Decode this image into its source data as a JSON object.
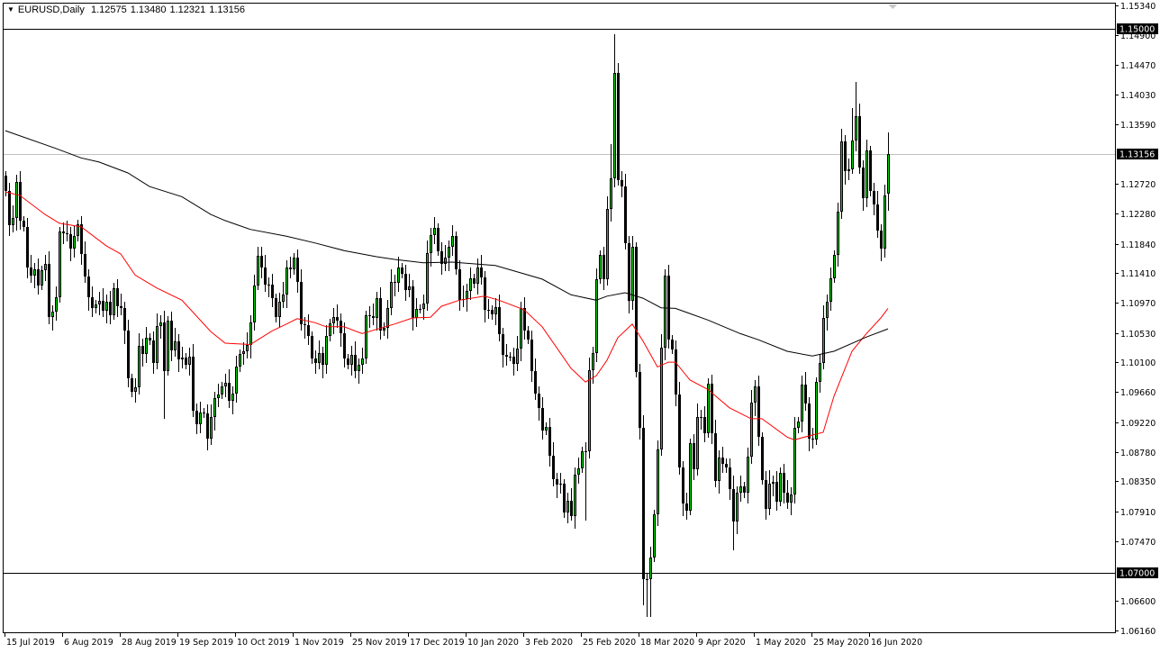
{
  "header": {
    "symbol": "EURUSD,Daily",
    "open": "1.12575",
    "high": "1.13480",
    "low": "1.12321",
    "close": "1.13156"
  },
  "colors": {
    "bull": "#00d000",
    "bear": "#000000",
    "ma_fast": "#ff0000",
    "ma_slow": "#000000",
    "bid_line": "#c0c0c0",
    "hline": "#000000"
  },
  "chart_data": {
    "type": "candlestick",
    "title": "EURUSD,Daily",
    "ylim": [
      1.0616,
      1.1534
    ],
    "y_ticks": [
      "1.15340",
      "1.14900",
      "1.14470",
      "1.14030",
      "1.13590",
      "1.12720",
      "1.12280",
      "1.11840",
      "1.11410",
      "1.10970",
      "1.10530",
      "1.10100",
      "1.09660",
      "1.09220",
      "1.08780",
      "1.08350",
      "1.07910",
      "1.07470",
      "1.06600",
      "1.06160"
    ],
    "x_labels": [
      {
        "label": "15 Jul 2019",
        "bar": 0
      },
      {
        "label": "6 Aug 2019",
        "bar": 16
      },
      {
        "label": "28 Aug 2019",
        "bar": 32
      },
      {
        "label": "19 Sep 2019",
        "bar": 48
      },
      {
        "label": "10 Oct 2019",
        "bar": 64
      },
      {
        "label": "1 Nov 2019",
        "bar": 80
      },
      {
        "label": "25 Nov 2019",
        "bar": 96
      },
      {
        "label": "17 Dec 2019",
        "bar": 112
      },
      {
        "label": "10 Jan 2020",
        "bar": 128
      },
      {
        "label": "3 Feb 2020",
        "bar": 144
      },
      {
        "label": "25 Feb 2020",
        "bar": 160
      },
      {
        "label": "18 Mar 2020",
        "bar": 176
      },
      {
        "label": "9 Apr 2020",
        "bar": 192
      },
      {
        "label": "1 May 2020",
        "bar": 208
      },
      {
        "label": "25 May 2020",
        "bar": 224
      },
      {
        "label": "16 Jun 2020",
        "bar": 240
      }
    ],
    "first_open": 1.1284,
    "closes": [
      1.1261,
      1.1211,
      1.1222,
      1.1275,
      1.1218,
      1.1209,
      1.1149,
      1.1137,
      1.1146,
      1.1123,
      1.1145,
      1.1154,
      1.1076,
      1.1084,
      1.1105,
      1.1202,
      1.1199,
      1.1198,
      1.1177,
      1.1195,
      1.1212,
      1.1169,
      1.1136,
      1.1105,
      1.1089,
      1.1095,
      1.11,
      1.1086,
      1.1099,
      1.1079,
      1.1119,
      1.1092,
      1.1089,
      1.1056,
      1.0986,
      1.0966,
      1.0973,
      1.1034,
      1.1022,
      1.1046,
      1.1042,
      1.1009,
      1.1063,
      1.1069,
      1.0997,
      1.1071,
      1.1028,
      1.1041,
      1.1014,
      1.1017,
      1.1006,
      1.1018,
      1.0939,
      1.0919,
      1.0936,
      1.0935,
      1.0898,
      1.0929,
      1.0957,
      1.0963,
      1.0974,
      1.098,
      1.0953,
      1.0964,
      1.1003,
      1.1022,
      1.1026,
      1.1035,
      1.1069,
      1.1123,
      1.1166,
      1.1149,
      1.1124,
      1.1124,
      1.1104,
      1.1076,
      1.1099,
      1.1109,
      1.1149,
      1.1146,
      1.1163,
      1.1128,
      1.1066,
      1.1064,
      1.1048,
      1.1015,
      1.1009,
      1.1023,
      1.1006,
      1.1048,
      1.1067,
      1.1076,
      1.1071,
      1.1052,
      1.1015,
      1.1006,
      1.1021,
      1.0997,
      1.1006,
      1.1015,
      1.1079,
      1.1077,
      1.1075,
      1.1104,
      1.1056,
      1.1061,
      1.1089,
      1.1128,
      1.1126,
      1.1149,
      1.114,
      1.1116,
      1.1121,
      1.1075,
      1.1088,
      1.1088,
      1.1096,
      1.117,
      1.1197,
      1.1207,
      1.1173,
      1.1154,
      1.1163,
      1.1179,
      1.1195,
      1.1146,
      1.1101,
      1.1103,
      1.1115,
      1.1133,
      1.1125,
      1.1149,
      1.1134,
      1.1087,
      1.1087,
      1.108,
      1.1091,
      1.1051,
      1.1021,
      1.1018,
      1.1018,
      1.1007,
      1.103,
      1.1089,
      1.1056,
      1.1043,
      1.0997,
      1.0964,
      1.0943,
      1.091,
      1.0915,
      1.0873,
      1.0838,
      1.083,
      1.0831,
      1.0789,
      1.0806,
      1.0784,
      1.0845,
      1.0854,
      1.0879,
      1.0879,
      1.0998,
      1.1023,
      1.1132,
      1.1167,
      1.1132,
      1.1235,
      1.128,
      1.1435,
      1.1277,
      1.1268,
      1.1185,
      1.11,
      1.1179,
      1.0995,
      1.0913,
      1.0691,
      1.0691,
      1.0723,
      1.0786,
      1.0882,
      1.1032,
      1.1137,
      1.1043,
      1.1029,
      1.0962,
      1.0855,
      1.0803,
      1.0792,
      1.0891,
      1.0853,
      1.093,
      1.093,
      1.0906,
      1.0979,
      1.0906,
      1.0836,
      1.087,
      1.0861,
      1.0855,
      1.0824,
      1.0776,
      1.0818,
      1.0827,
      1.0818,
      1.0871,
      1.095,
      1.0974,
      1.09,
      1.0837,
      1.0795,
      1.0832,
      1.0834,
      1.0805,
      1.0848,
      1.0818,
      1.0804,
      1.0816,
      1.0913,
      1.0923,
      1.0977,
      1.0949,
      1.0898,
      1.0896,
      1.0981,
      1.1009,
      1.1075,
      1.1099,
      1.1133,
      1.1167,
      1.1231,
      1.1334,
      1.129,
      1.1293,
      1.1336,
      1.1371,
      1.1296,
      1.1251,
      1.1321,
      1.1261,
      1.1242,
      1.1203,
      1.1177,
      1.1255,
      1.13156
    ],
    "last_bar": {
      "open": 1.12575,
      "high": 1.1348,
      "low": 1.12321,
      "close": 1.13156
    },
    "wick_overrides": [
      {
        "bar": 169,
        "high": 1.1492
      },
      {
        "bar": 170,
        "high": 1.1449
      },
      {
        "bar": 168,
        "high": 1.133
      },
      {
        "bar": 177,
        "low": 1.0653
      },
      {
        "bar": 178,
        "low": 1.0636
      },
      {
        "bar": 179,
        "low": 1.0636
      },
      {
        "bar": 236,
        "high": 1.1422
      },
      {
        "bar": 235,
        "high": 1.1383
      },
      {
        "bar": 202,
        "low": 1.0734
      },
      {
        "bar": 161,
        "low": 1.0777
      },
      {
        "bar": 157,
        "low": 1.0777
      },
      {
        "bar": 56,
        "low": 1.0881
      },
      {
        "bar": 44,
        "low": 1.0927
      },
      {
        "bar": 53,
        "low": 1.0905
      },
      {
        "bar": 70,
        "high": 1.118
      }
    ],
    "series": [
      {
        "name": "ma-fast",
        "color": "#ff0000",
        "points": [
          [
            0,
            1.126
          ],
          [
            4,
            1.1255
          ],
          [
            11,
            1.1227
          ],
          [
            15,
            1.1214
          ],
          [
            21,
            1.1209
          ],
          [
            28,
            1.1181
          ],
          [
            32,
            1.1169
          ],
          [
            36,
            1.1138
          ],
          [
            42,
            1.1119
          ],
          [
            49,
            1.1101
          ],
          [
            57,
            1.1055
          ],
          [
            61,
            1.1038
          ],
          [
            68,
            1.1036
          ],
          [
            74,
            1.1056
          ],
          [
            78,
            1.1066
          ],
          [
            81,
            1.1074
          ],
          [
            86,
            1.1068
          ],
          [
            89,
            1.1062
          ],
          [
            94,
            1.1062
          ],
          [
            99,
            1.1052
          ],
          [
            108,
            1.1066
          ],
          [
            113,
            1.1075
          ],
          [
            118,
            1.1076
          ],
          [
            121,
            1.1092
          ],
          [
            126,
            1.1101
          ],
          [
            133,
            1.1107
          ],
          [
            137,
            1.1101
          ],
          [
            144,
            1.1087
          ],
          [
            149,
            1.1062
          ],
          [
            157,
            1.1001
          ],
          [
            161,
            1.0981
          ],
          [
            164,
            1.099
          ],
          [
            167,
            1.1013
          ],
          [
            170,
            1.1046
          ],
          [
            174,
            1.1066
          ],
          [
            177,
            1.1041
          ],
          [
            181,
            1.1003
          ],
          [
            184,
            1.101
          ],
          [
            186,
            1.101
          ],
          [
            190,
            1.0984
          ],
          [
            195,
            1.097
          ],
          [
            201,
            1.0943
          ],
          [
            207,
            1.0927
          ],
          [
            210,
            1.0927
          ],
          [
            217,
            1.09
          ],
          [
            219,
            1.0896
          ],
          [
            224,
            1.0903
          ],
          [
            227,
            1.0907
          ],
          [
            230,
            1.096
          ],
          [
            235,
            1.1026
          ],
          [
            239,
            1.1052
          ],
          [
            243,
            1.1075
          ],
          [
            245,
            1.1089
          ]
        ]
      },
      {
        "name": "ma-slow",
        "color": "#000000",
        "points": [
          [
            0,
            1.135
          ],
          [
            14,
            1.1324
          ],
          [
            21,
            1.131
          ],
          [
            26,
            1.1304
          ],
          [
            34,
            1.1288
          ],
          [
            40,
            1.1268
          ],
          [
            49,
            1.1253
          ],
          [
            57,
            1.1227
          ],
          [
            61,
            1.1218
          ],
          [
            68,
            1.1205
          ],
          [
            78,
            1.1195
          ],
          [
            86,
            1.1185
          ],
          [
            94,
            1.1174
          ],
          [
            103,
            1.1165
          ],
          [
            108,
            1.1161
          ],
          [
            116,
            1.1156
          ],
          [
            124,
            1.1157
          ],
          [
            136,
            1.1152
          ],
          [
            149,
            1.1132
          ],
          [
            157,
            1.1109
          ],
          [
            164,
            1.1101
          ],
          [
            167,
            1.1107
          ],
          [
            172,
            1.1112
          ],
          [
            177,
            1.1104
          ],
          [
            182,
            1.109
          ],
          [
            186,
            1.1089
          ],
          [
            195,
            1.1072
          ],
          [
            204,
            1.1052
          ],
          [
            209,
            1.1043
          ],
          [
            217,
            1.1026
          ],
          [
            224,
            1.1019
          ],
          [
            230,
            1.1026
          ],
          [
            239,
            1.1047
          ],
          [
            245,
            1.1059
          ]
        ]
      }
    ],
    "hlines": [
      {
        "value": 1.15,
        "label": "1.15000"
      },
      {
        "value": 1.07,
        "label": "1.07000"
      }
    ],
    "bid_line": {
      "value": 1.13156,
      "label": "1.13156"
    }
  }
}
